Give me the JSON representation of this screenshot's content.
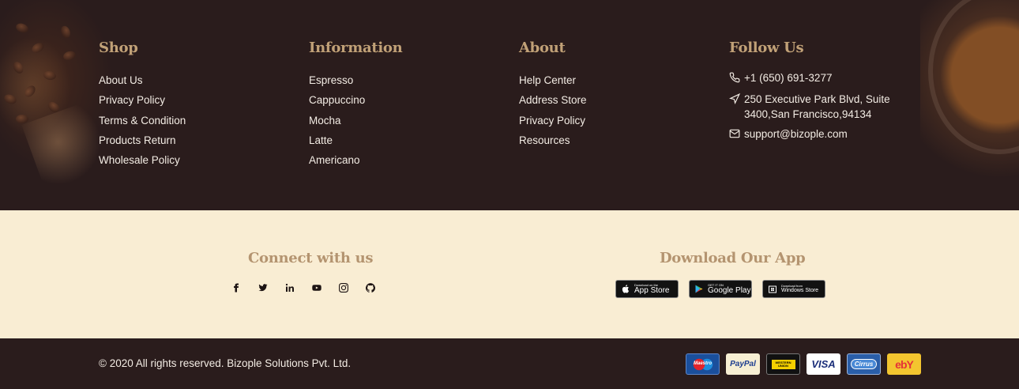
{
  "columns": {
    "shop": {
      "title": "Shop",
      "links": [
        "About Us",
        "Privacy Policy",
        "Terms & Condition",
        "Products Return",
        "Wholesale Policy"
      ]
    },
    "information": {
      "title": "Information",
      "links": [
        "Espresso",
        "Cappuccino",
        "Mocha",
        "Latte",
        "Americano"
      ]
    },
    "about": {
      "title": "About",
      "links": [
        "Help Center",
        "Address Store",
        "Privacy Policy",
        "Resources"
      ]
    },
    "follow": {
      "title": "Follow Us",
      "phone": "+1 (650) 691-3277",
      "address": "250 Executive Park Blvd, Suite 3400,San Francisco,94134",
      "email": "support@bizople.com"
    }
  },
  "connect": {
    "title": "Connect with us",
    "icons": [
      "facebook-icon",
      "twitter-icon",
      "linkedin-icon",
      "youtube-icon",
      "instagram-icon",
      "github-icon"
    ]
  },
  "download": {
    "title": "Download Our App",
    "apps": [
      {
        "small": "Download on the",
        "big": "App Store",
        "icon": "apple-icon"
      },
      {
        "small": "GET IT ON",
        "big": "Google Play",
        "icon": "google-play-icon"
      },
      {
        "small": "Download from",
        "big": "Windows Store",
        "icon": "windows-icon"
      }
    ]
  },
  "copyright": "© 2020 All rights reserved. Bizople Solutions Pvt. Ltd.",
  "payments": [
    "Maestro",
    "PayPal",
    "WESTERN UNION",
    "VISA",
    "Cirrus",
    "ebY"
  ],
  "colors": {
    "dark_bg": "#2a1c1c",
    "cream_bg": "#f9edd3",
    "heading_gold": "#c1a177",
    "link_text": "#f3ece4"
  }
}
